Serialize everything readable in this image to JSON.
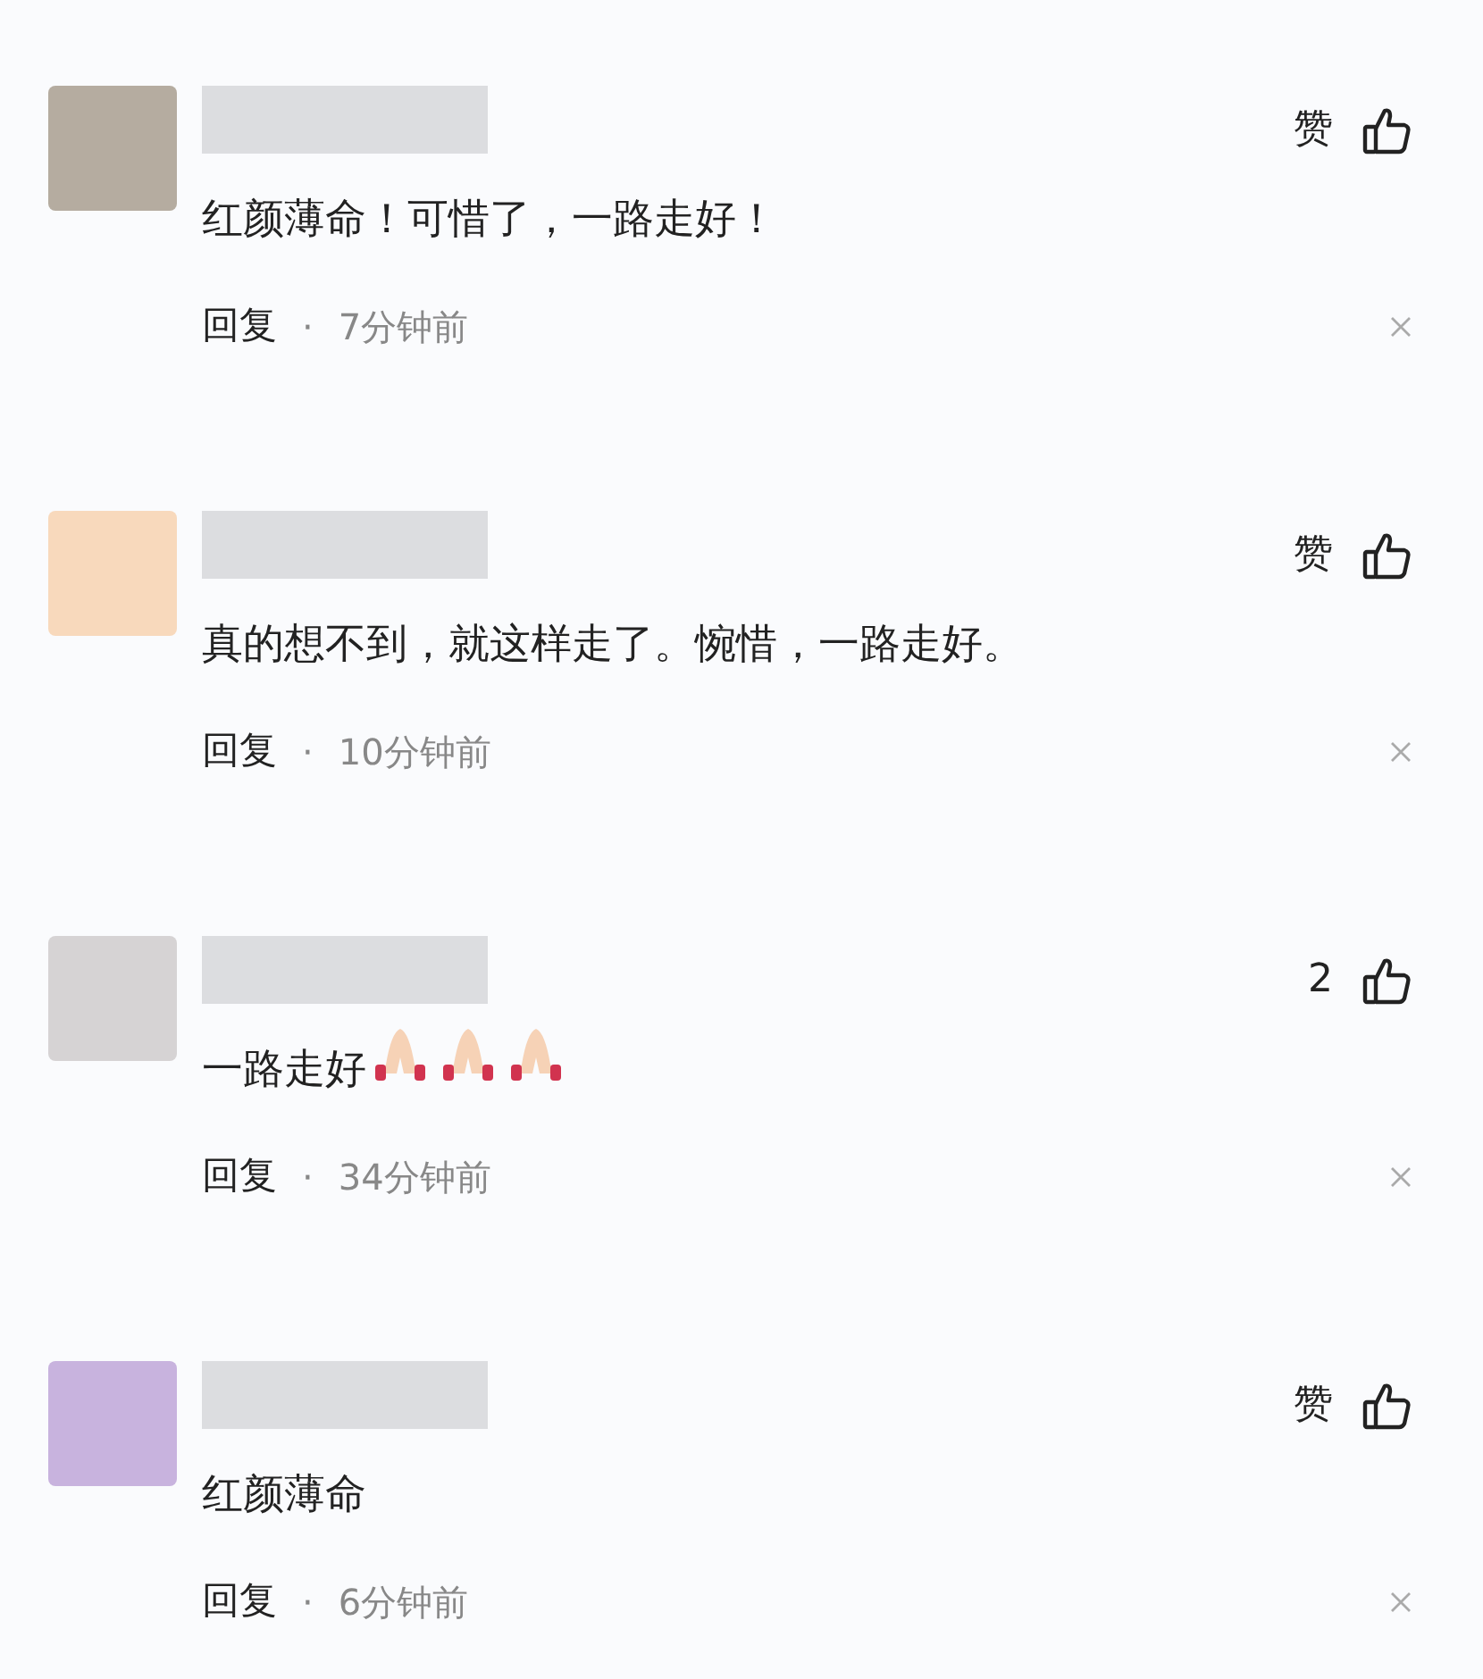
{
  "comments": [
    {
      "avatar": {
        "color": "#b5aca0"
      },
      "like_label": "赞",
      "text": "红颜薄命！可惜了，一路走好！",
      "reply": "回复",
      "separator": "·",
      "time": "7分钟前"
    },
    {
      "avatar": {
        "color": "#f8d9bc"
      },
      "like_label": "赞",
      "text": "真的想不到，就这样走了。惋惜，一路走好。",
      "reply": "回复",
      "separator": "·",
      "time": "10分钟前"
    },
    {
      "avatar": {
        "color": "#d6d3d4"
      },
      "like_label": "2",
      "text": "一路走好",
      "emojis": [
        {
          "kind": "pray"
        },
        {
          "kind": "pray"
        },
        {
          "kind": "pray"
        }
      ],
      "reply": "回复",
      "separator": "·",
      "time": "34分钟前"
    },
    {
      "avatar": {
        "color": "#c8b3de"
      },
      "like_label": "赞",
      "text": "红颜薄命",
      "reply": "回复",
      "separator": "·",
      "time": "6分钟前"
    }
  ]
}
